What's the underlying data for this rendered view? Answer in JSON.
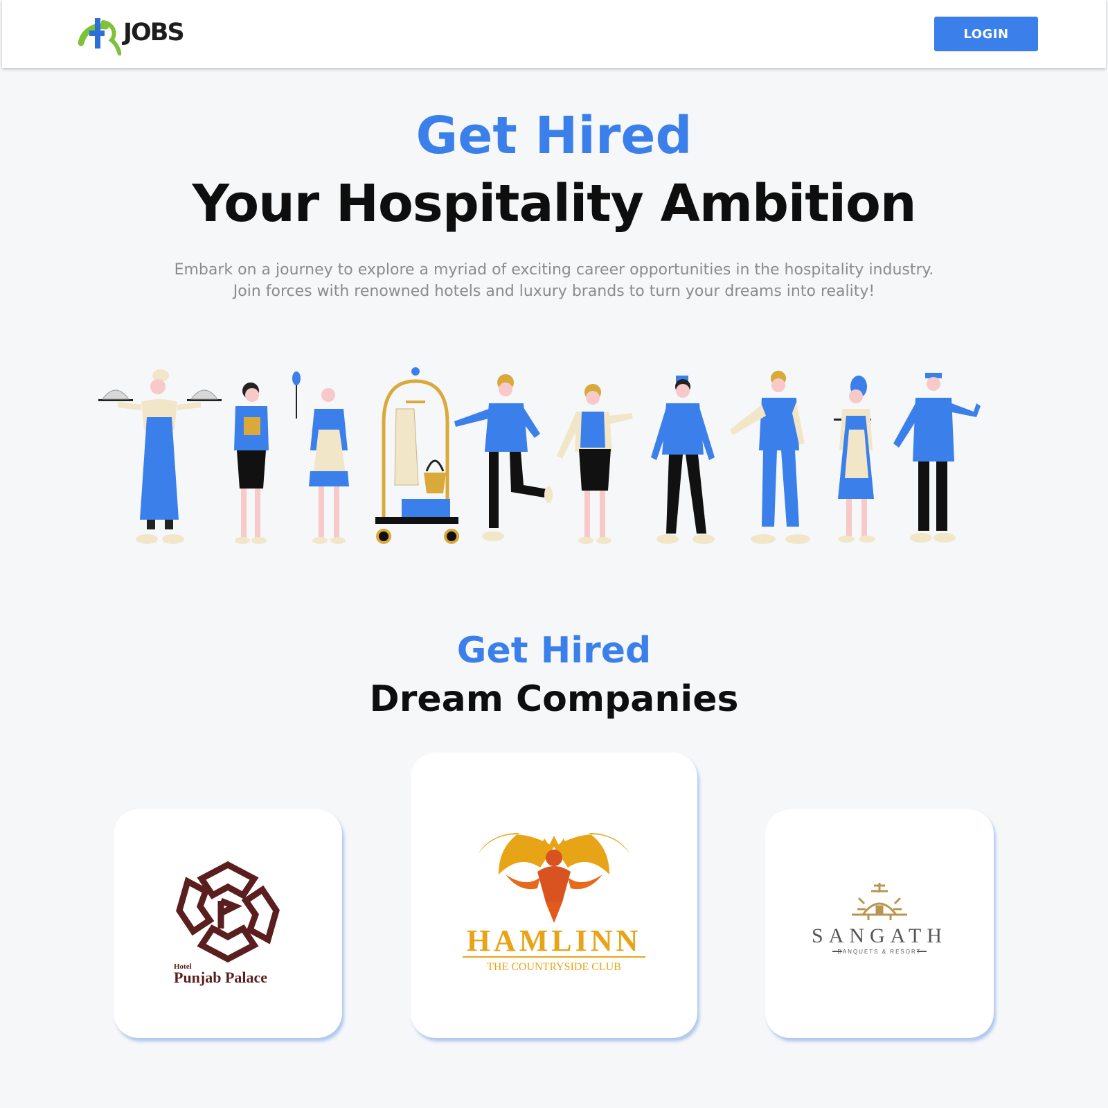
{
  "navbar": {
    "logo_text": "JOBS",
    "login_label": "LOGIN"
  },
  "hero": {
    "title_accent": "Get Hired",
    "title_main": "Your Hospitality Ambition",
    "description_line1": "Embark on a journey to explore a myriad of exciting career opportunities in the hospitality industry.",
    "description_line2": "Join forces with renowned hotels and luxury brands to turn your dreams into reality!"
  },
  "companies": {
    "title_accent": "Get Hired",
    "title_main": "Dream Companies",
    "items": [
      {
        "prefix": "Hotel",
        "name": "Punjab Palace"
      },
      {
        "name": "HAMLINN",
        "tagline": "THE COUNTRYSIDE CLUB"
      },
      {
        "name": "SANGATH",
        "tagline": "BANQUETS & RESORT"
      }
    ]
  },
  "colors": {
    "accent": "#3b80ea",
    "background": "#f5f7f9",
    "punjab_brand": "#5a1e1e",
    "hamlinn_brand": "#e8a417",
    "sangath_gold": "#b89550"
  },
  "icons": [
    "jobs-logo-icon",
    "punjab-palace-emblem-icon",
    "phoenix-emblem-icon",
    "sangath-emblem-icon"
  ]
}
